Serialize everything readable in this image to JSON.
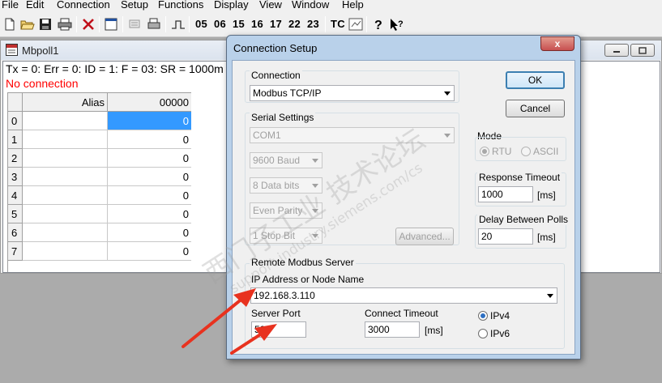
{
  "menubar": {
    "items": [
      "File",
      "Edit",
      "Connection",
      "Setup",
      "Functions",
      "Display",
      "View",
      "Window",
      "Help"
    ]
  },
  "toolbar": {
    "function_codes": [
      "05",
      "06",
      "15",
      "16",
      "17",
      "22",
      "23"
    ],
    "tc_label": "TC"
  },
  "mbpoll": {
    "title": "Mbpoll1",
    "status_line": "Tx = 0: Err = 0: ID = 1: F = 03: SR = 1000m",
    "connection_status": "No connection",
    "grid": {
      "headers": [
        "Alias",
        "00000"
      ],
      "row_numbers": [
        "0",
        "1",
        "2",
        "3",
        "4",
        "5",
        "6",
        "7"
      ],
      "values": [
        "0",
        "0",
        "0",
        "0",
        "0",
        "0",
        "0",
        "0"
      ],
      "selected_row": 0
    }
  },
  "dialog": {
    "title": "Connection Setup",
    "close_label": "x",
    "connection": {
      "group_label": "Connection",
      "value": "Modbus TCP/IP"
    },
    "serial": {
      "group_label": "Serial Settings",
      "port": "COM1",
      "baud": "9600 Baud",
      "data_bits": "8 Data bits",
      "parity": "Even Parity",
      "stop_bits": "1 Stop Bit",
      "advanced_label": "Advanced..."
    },
    "ok_label": "OK",
    "cancel_label": "Cancel",
    "mode": {
      "label": "Mode",
      "options": [
        "RTU",
        "ASCII"
      ],
      "selected": "RTU"
    },
    "response_timeout": {
      "label": "Response Timeout",
      "value": "1000",
      "unit": "[ms]"
    },
    "delay_polls": {
      "label": "Delay Between Polls",
      "value": "20",
      "unit": "[ms]"
    },
    "remote": {
      "group_label": "Remote Modbus Server",
      "ip_label": "IP Address or Node Name",
      "ip_value": "192.168.3.110",
      "port_label": "Server Port",
      "port_value": "502",
      "connect_timeout_label": "Connect Timeout",
      "connect_timeout_value": "3000",
      "connect_timeout_unit": "[ms]",
      "ip_versions": [
        "IPv4",
        "IPv6"
      ],
      "ip_version_selected": "IPv4"
    }
  },
  "watermark": {
    "cn": "西门子工业 技术论坛",
    "url": "support.industry.siemens.com/cs"
  },
  "colors": {
    "selection": "#3399ff",
    "error_text": "#ff0000",
    "annotation_arrow": "#e8321f",
    "dialog_frame": "#b9d1ea",
    "close_button": "#c75050"
  }
}
